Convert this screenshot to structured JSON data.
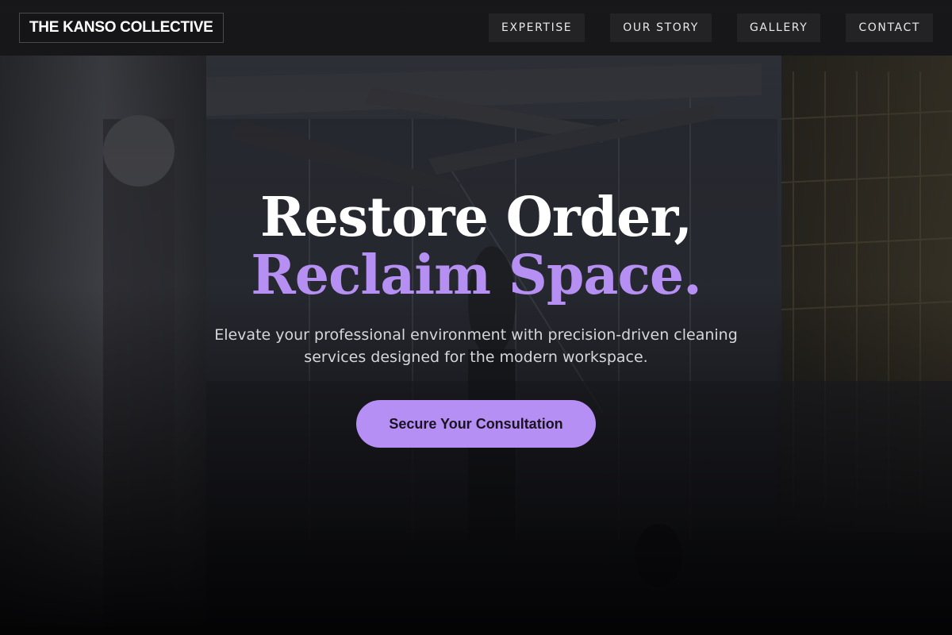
{
  "brand": {
    "name": "THE KANSO COLLECTIVE"
  },
  "nav": {
    "items": [
      {
        "label": "EXPERTISE"
      },
      {
        "label": "OUR STORY"
      },
      {
        "label": "GALLERY"
      },
      {
        "label": "CONTACT"
      }
    ]
  },
  "hero": {
    "headline_line1": "Restore Order,",
    "headline_line2": "Reclaim Space.",
    "subtitle": "Elevate your professional environment with precision-driven cleaning services designed for the modern workspace.",
    "cta_label": "Secure Your Consultation"
  },
  "colors": {
    "accent": "#b68ff2",
    "header_bg": "#161618",
    "page_bg": "#0b0b0d"
  }
}
